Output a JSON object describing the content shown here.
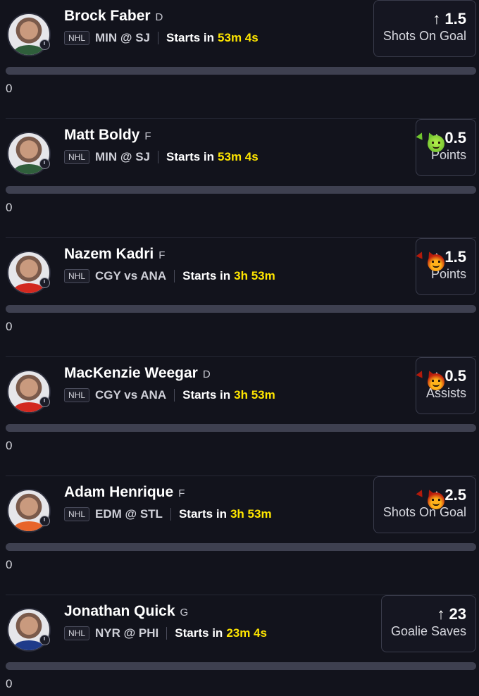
{
  "players": [
    {
      "name": "Brock Faber",
      "position": "D",
      "league": "NHL",
      "matchup": "MIN @ SJ",
      "starts_label": "Starts in",
      "countdown": "53m 4s",
      "direction": "↑",
      "line": "1.5",
      "stat": "Shots On Goal",
      "emoji": "",
      "progress_value": "0",
      "progress_fraction": 0,
      "jersey_color": "#2f5e3b"
    },
    {
      "name": "Matt Boldy",
      "position": "F",
      "league": "NHL",
      "matchup": "MIN @ SJ",
      "starts_label": "Starts in",
      "countdown": "53m 4s",
      "direction": "↑",
      "line": "0.5",
      "stat": "Points",
      "emoji": "green-devil-icon",
      "progress_value": "0",
      "progress_fraction": 0,
      "jersey_color": "#2f5e3b"
    },
    {
      "name": "Nazem Kadri",
      "position": "F",
      "league": "NHL",
      "matchup": "CGY vs ANA",
      "starts_label": "Starts in",
      "countdown": "3h 53m",
      "direction": "↑",
      "line": "1.5",
      "stat": "Points",
      "emoji": "red-devil-icon",
      "progress_value": "0",
      "progress_fraction": 0,
      "jersey_color": "#d2281f"
    },
    {
      "name": "MacKenzie Weegar",
      "position": "D",
      "league": "NHL",
      "matchup": "CGY vs ANA",
      "starts_label": "Starts in",
      "countdown": "3h 53m",
      "direction": "↑",
      "line": "0.5",
      "stat": "Assists",
      "emoji": "red-devil-icon",
      "progress_value": "0",
      "progress_fraction": 0,
      "jersey_color": "#d2281f"
    },
    {
      "name": "Adam Henrique",
      "position": "F",
      "league": "NHL",
      "matchup": "EDM @ STL",
      "starts_label": "Starts in",
      "countdown": "3h 53m",
      "direction": "↑",
      "line": "2.5",
      "stat": "Shots On Goal",
      "emoji": "red-devil-icon",
      "progress_value": "0",
      "progress_fraction": 0,
      "jersey_color": "#e8642a"
    },
    {
      "name": "Jonathan Quick",
      "position": "G",
      "league": "NHL",
      "matchup": "NYR @ PHI",
      "starts_label": "Starts in",
      "countdown": "23m 4s",
      "direction": "↑",
      "line": "23",
      "stat": "Goalie Saves",
      "emoji": "",
      "progress_value": "0",
      "progress_fraction": 0,
      "jersey_color": "#1f3b8a"
    }
  ],
  "colors": {
    "background": "#12131c",
    "countdown": "#ffe600",
    "progress_track": "#3e4050"
  }
}
